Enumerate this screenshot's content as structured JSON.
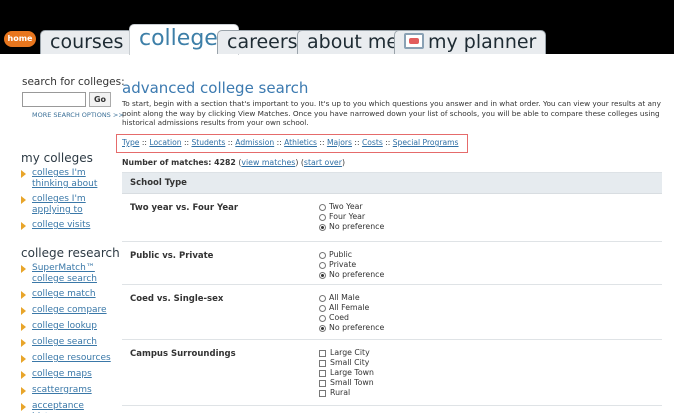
{
  "nav": {
    "home": "home",
    "tabs": [
      "courses",
      "colleges",
      "careers",
      "about me",
      "my planner"
    ]
  },
  "sidebar": {
    "search_label": "search for colleges:",
    "search_value": "",
    "go": "Go",
    "more_options": "MORE SEARCH OPTIONS >>",
    "my_colleges_heading": "my colleges",
    "my_colleges": [
      "colleges I'm thinking about",
      "colleges I'm applying to",
      "college visits"
    ],
    "college_research_heading": "college research",
    "college_research": [
      "SuperMatch™ college search",
      "college match",
      "college compare",
      "college lookup",
      "college search",
      "college resources",
      "college maps",
      "scattergrams",
      "acceptance history"
    ]
  },
  "main": {
    "title": "advanced college search",
    "intro": "To start, begin with a section that's important to you. It's up to you which questions you answer and in what order. You can view your results at any point along the way by clicking View Matches. Once you have narrowed down your list of schools, you will be able to compare these colleges using historical admissions results from your own school.",
    "categories": [
      "Type",
      "Location",
      "Students",
      "Admission",
      "Athletics",
      "Majors",
      "Costs",
      "Special Programs"
    ],
    "separator": " :: ",
    "matches_label": "Number of matches:",
    "matches_count": "4282",
    "view_matches": "view matches",
    "start_over": "start over",
    "section_title": "School Type",
    "questions": [
      {
        "label": "Two year vs. Four Year",
        "type": "radio",
        "options": [
          "Two Year",
          "Four Year",
          "No preference"
        ],
        "selected": 2
      },
      {
        "label": "Public vs. Private",
        "type": "radio",
        "options": [
          "Public",
          "Private",
          "No preference"
        ],
        "selected": 2
      },
      {
        "label": "Coed vs. Single-sex",
        "type": "radio",
        "options": [
          "All Male",
          "All Female",
          "Coed",
          "No preference"
        ],
        "selected": 3
      },
      {
        "label": "Campus Surroundings",
        "type": "checkbox",
        "options": [
          "Large City",
          "Small City",
          "Large Town",
          "Small Town",
          "Rural"
        ],
        "selected": -1
      }
    ]
  },
  "colors": {
    "accent": "#3c7ab0",
    "link": "#2f6fa5",
    "home_pill": "#e8761e",
    "highlight_box": "#e56b6b"
  }
}
